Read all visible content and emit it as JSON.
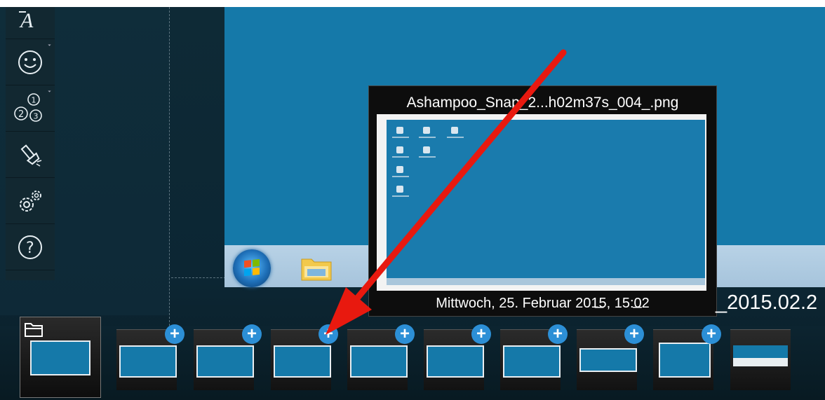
{
  "preview": {
    "title": "Ashampoo_Snap_2...h02m37s_004_.png",
    "date": "Mittwoch, 25. Februar 2015, 15:02"
  },
  "filename_strip": {
    "fragment": "_ _",
    "text": "_2015.02.2"
  },
  "toolbar": {
    "tools": [
      {
        "icon": "text-icon"
      },
      {
        "icon": "smiley-icon"
      },
      {
        "icon": "numbering-icon"
      },
      {
        "icon": "spotlight-icon"
      },
      {
        "icon": "settings-icon"
      },
      {
        "icon": "help-icon"
      }
    ]
  },
  "thumbnails": {
    "add_symbol": "+",
    "count": 9,
    "current_icon": "folder-icon"
  },
  "colors": {
    "desktop": "#1579a9",
    "annotation_arrow": "#e8190f",
    "add_button": "#2c8fd6"
  }
}
